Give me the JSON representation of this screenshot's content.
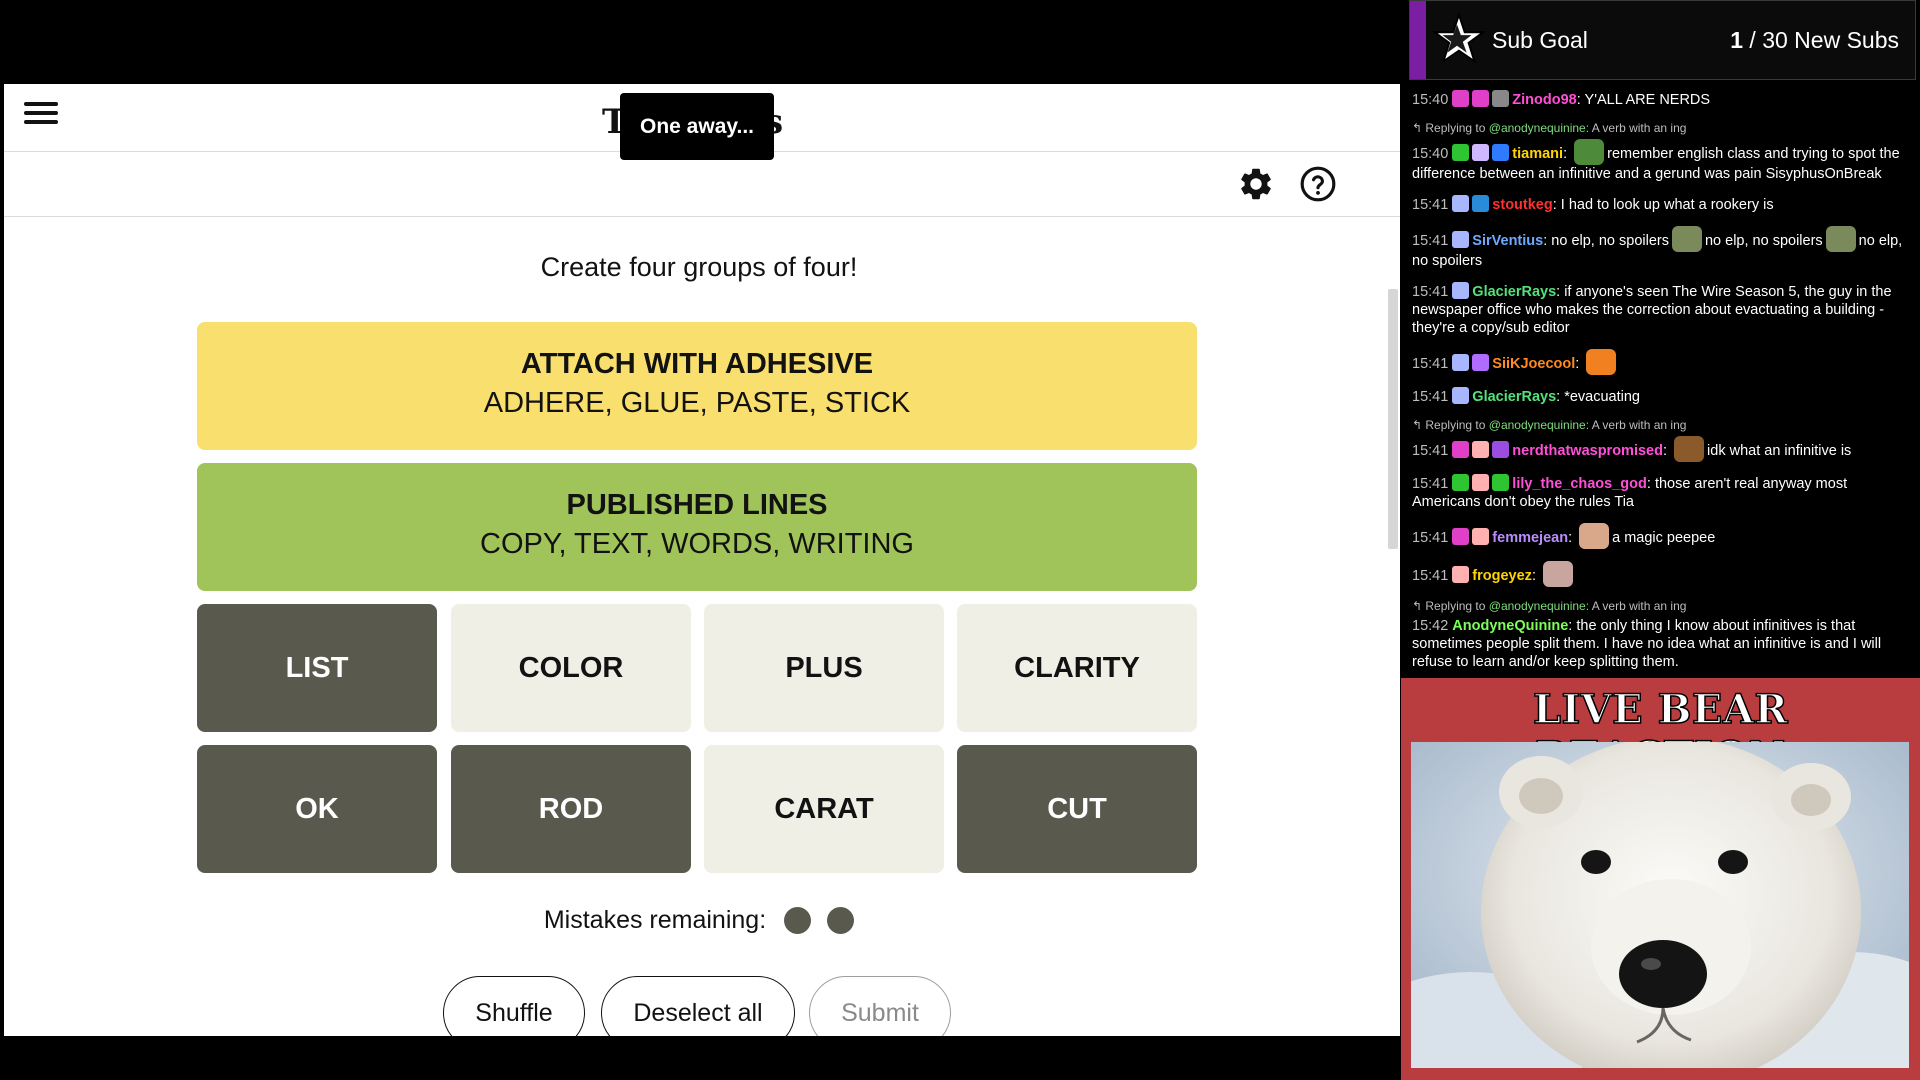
{
  "game": {
    "logo_left_fragment": "T",
    "logo_right_fragment": "s",
    "toast": "One away...",
    "instruction": "Create four groups of four!",
    "solved_groups": [
      {
        "category": "ATTACH WITH ADHESIVE",
        "words": "ADHERE, GLUE, PASTE, STICK",
        "color": "#f9df6d"
      },
      {
        "category": "PUBLISHED LINES",
        "words": "COPY, TEXT, WORDS, WRITING",
        "color": "#a0c35a"
      }
    ],
    "tiles": [
      {
        "label": "LIST",
        "selected": true
      },
      {
        "label": "COLOR",
        "selected": false
      },
      {
        "label": "PLUS",
        "selected": false
      },
      {
        "label": "CLARITY",
        "selected": false
      },
      {
        "label": "OK",
        "selected": true
      },
      {
        "label": "ROD",
        "selected": true
      },
      {
        "label": "CARAT",
        "selected": false
      },
      {
        "label": "CUT",
        "selected": true
      }
    ],
    "mistakes_label": "Mistakes remaining:",
    "mistakes_remaining": 2,
    "buttons": {
      "shuffle": "Shuffle",
      "deselect": "Deselect all",
      "submit": "Submit"
    },
    "icons": {
      "menu": "hamburger-icon",
      "settings": "gear-icon",
      "help": "question-circle-icon"
    }
  },
  "subgoal": {
    "label": "Sub Goal",
    "current": "1",
    "rest": " / 30 New Subs",
    "icon": "star-icon",
    "accent_color": "#7a1fa2"
  },
  "chat": {
    "messages": [
      {
        "time": "15:40",
        "user": "Zinodo98",
        "color": "#ff4fd8",
        "text": "Y'ALL ARE NERDS",
        "badges": [
          "#e040c8",
          "#e040c8",
          "#888888"
        ]
      },
      {
        "reply_to": "@anodynequinine:",
        "reply_text": "A verb with an ing",
        "reply_prefix": "Replying to"
      },
      {
        "time": "15:40",
        "user": "tiamani",
        "color": "#ffd400",
        "text": "remember english class and trying to spot the difference between an infinitive and a gerund was pain SisyphusOnBreak",
        "badges": [
          "#2ec432",
          "#d0b8ff",
          "#2f7bff"
        ],
        "emote": "#4d8a3a"
      },
      {
        "time": "15:41",
        "user": "stoutkeg",
        "color": "#ff3030",
        "text": "I had to look up what a rookery is",
        "badges": [
          "#a7b6ff",
          "#2a8bd8"
        ]
      },
      {
        "time": "15:41",
        "user": "SirVentius",
        "color": "#6fa9ff",
        "text": "no elp, no spoilers",
        "text2": "no elp, no spoilers",
        "text3": "no elp, no spoilers",
        "badges": [
          "#a7b6ff"
        ]
      },
      {
        "time": "15:41",
        "user": "GlacierRays",
        "color": "#55e07a",
        "text": "if anyone's seen The Wire Season 5, the guy in the newspaper office who makes the correction about evactuating a building - they're a copy/sub editor",
        "badges": [
          "#a7b6ff"
        ]
      },
      {
        "time": "15:41",
        "user": "SiiKJoecool",
        "color": "#ff8a1f",
        "text": "",
        "badges": [
          "#a7b6ff",
          "#b06cff"
        ],
        "emote": "#f08020"
      },
      {
        "time": "15:41",
        "user": "GlacierRays",
        "color": "#55e07a",
        "text": "*evacuating",
        "badges": [
          "#a7b6ff"
        ]
      },
      {
        "reply_to": "@anodynequinine:",
        "reply_text": "A verb with an ing",
        "reply_prefix": "Replying to"
      },
      {
        "time": "15:41",
        "user": "nerdthatwaspromised",
        "color": "#ff4fd8",
        "text": "idk what an infinitive is",
        "badges": [
          "#e040c8",
          "#ffb0b0",
          "#9a4de0"
        ],
        "emote": "#8b5a2b"
      },
      {
        "time": "15:41",
        "user": "lily_the_chaos_god",
        "color": "#ff4fd8",
        "text": "those aren't real anyway most Americans don't obey the rules Tia",
        "badges": [
          "#2ec432",
          "#ffb0b0",
          "#2ec432"
        ]
      },
      {
        "time": "15:41",
        "user": "femmejean",
        "color": "#b98cff",
        "text": "a magic peepee",
        "badges": [
          "#e040c8",
          "#ffb0b0"
        ],
        "emote": "#d9a88a"
      },
      {
        "time": "15:41",
        "user": "frogeyez",
        "color": "#ffd400",
        "text": "",
        "badges": [
          "#ffb0b0"
        ],
        "emote": "#c9a5a0"
      },
      {
        "reply_to": "@anodynequinine:",
        "reply_text": "A verb with an ing",
        "reply_prefix": "Replying to"
      },
      {
        "time": "15:42",
        "user": "AnodyneQuinine",
        "color": "#7dff5a",
        "text": "the only thing I know about infinitives is that sometimes people split them. I have no idea what an infinitive is and I will refuse to learn and/or keep splitting them.",
        "badges": []
      }
    ]
  },
  "bear": {
    "title": "LIVE BEAR REACTION",
    "panel_color": "#b93d3f"
  }
}
